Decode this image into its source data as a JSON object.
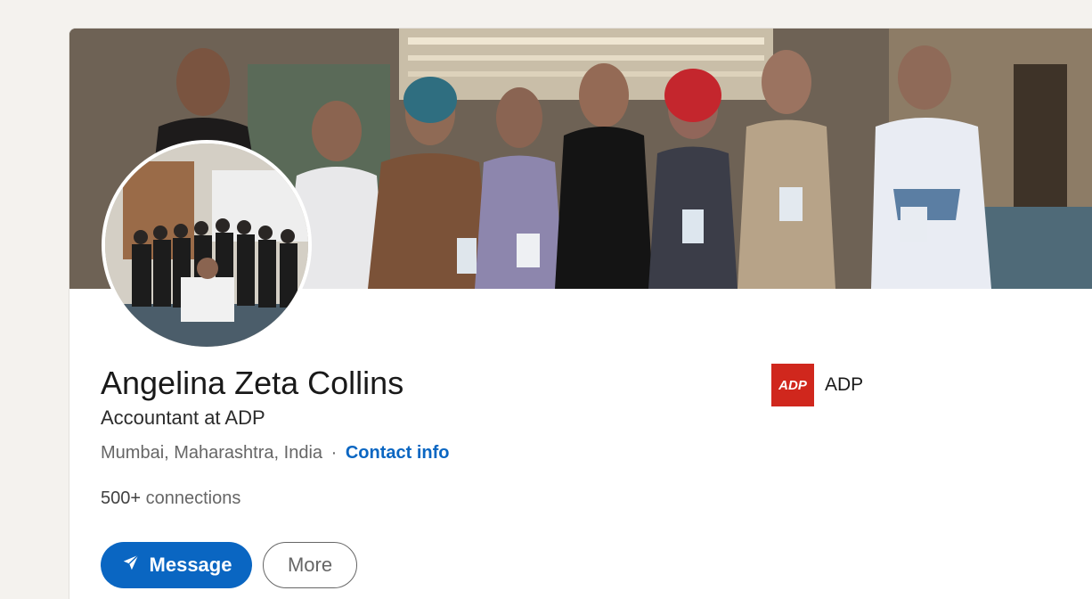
{
  "profile": {
    "name": "Angelina Zeta Collins",
    "headline": "Accountant at ADP",
    "location": "Mumbai, Maharashtra, India",
    "separator": "·",
    "contact_info_label": "Contact info",
    "connections_count": "500+",
    "connections_label": "connections"
  },
  "actions": {
    "message_label": "Message",
    "more_label": "More"
  },
  "company": {
    "name": "ADP",
    "logo_text": "ADP"
  },
  "colors": {
    "page_background": "#f4f2ee",
    "primary": "#0a66c2",
    "adp_red": "#d0271d"
  },
  "icons": {
    "message_button": "send-icon"
  }
}
